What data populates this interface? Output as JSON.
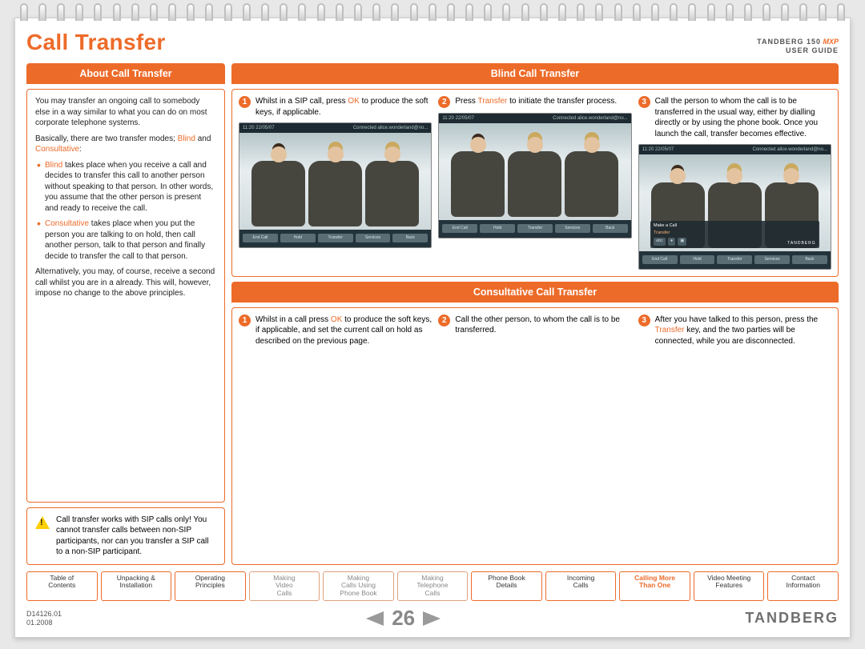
{
  "header": {
    "title": "Call Transfer",
    "brand": "TANDBERG 150",
    "model": "MXP",
    "subtitle": "USER GUIDE"
  },
  "sidebar": {
    "heading": "About Call Transfer",
    "para1": "You may transfer an ongoing call to somebody else in a way similar to what you can do on most corporate telephone systems.",
    "para2_a": "Basically, there are two transfer modes; ",
    "para2_b": "Blind",
    "para2_c": " and ",
    "para2_d": "Consultative",
    "para2_e": ":",
    "bullets": [
      {
        "lead": "Blind",
        "rest": " takes place when you receive a call and decides to transfer this call to another person without speaking to that person. In other words, you assume that the other person is present and ready to receive the call."
      },
      {
        "lead": "Consultative",
        "rest": " takes place when you put the person you are talking to on hold, then call another person, talk to that person and finally decide to transfer the call to that person."
      }
    ],
    "para3": "Alternatively, you may, of course, receive a second call whilst you are in a already. This will, however, impose no change to the above principles.",
    "warning": "Call transfer works with SIP calls only! You cannot transfer calls between non-SIP participants, nor can you transfer a SIP call to a non-SIP participant."
  },
  "blind": {
    "heading": "Blind Call Transfer",
    "steps": [
      {
        "n": "1",
        "pre": "Whilst in a SIP call, press ",
        "k": "OK",
        "post": " to produce the soft keys, if applicable."
      },
      {
        "n": "2",
        "pre": "Press ",
        "k": "Transfer",
        "post": " to initiate the transfer process."
      },
      {
        "n": "3",
        "pre": "",
        "k": "",
        "post": "Call the person to whom the call is to be transferred in the usual way, either by dialling directly or by using the phone book. Once you launch the call, transfer becomes effective."
      }
    ],
    "thumb_status_left": "11:20 22/05/07",
    "thumb_status_right": "Connected alice.wonderland@no...",
    "softkeys": [
      "End Call",
      "Hold",
      "Transfer",
      "Services",
      "Back"
    ],
    "menu_title": "Make a Call",
    "menu_item": "Transfer",
    "menu_brand": "TANDBERG"
  },
  "consult": {
    "heading": "Consultative Call Transfer",
    "steps": [
      {
        "n": "1",
        "pre": "Whilst in a call press ",
        "k": "OK",
        "post": " to produce the soft keys, if applicable, and set the current call on hold as described on the previous page."
      },
      {
        "n": "2",
        "pre": "",
        "k": "",
        "post": "Call the other person, to whom the call is to be transferred."
      },
      {
        "n": "3",
        "pre": "After you have talked to this person, press the ",
        "k": "Transfer",
        "post": " key, and the two parties will be connected, while you are disconnected."
      }
    ]
  },
  "crumbs": [
    {
      "l1": "Table of",
      "l2": "Contents",
      "state": "on"
    },
    {
      "l1": "Unpacking &",
      "l2": "Installation",
      "state": "on"
    },
    {
      "l1": "Operating",
      "l2": "Principles",
      "state": "on"
    },
    {
      "l1": "Making",
      "l2": "Video",
      "l3": "Calls",
      "state": "off"
    },
    {
      "l1": "Making",
      "l2": "Calls Using",
      "l3": "Phone Book",
      "state": "off"
    },
    {
      "l1": "Making",
      "l2": "Telephone",
      "l3": "Calls",
      "state": "off"
    },
    {
      "l1": "Phone Book",
      "l2": "Details",
      "state": "on"
    },
    {
      "l1": "Incoming",
      "l2": "Calls",
      "state": "on"
    },
    {
      "l1": "Calling More",
      "l2": "Than One",
      "state": "active"
    },
    {
      "l1": "Video Meeting",
      "l2": "Features",
      "state": "on"
    },
    {
      "l1": "Contact",
      "l2": "Information",
      "state": "on"
    }
  ],
  "footer": {
    "doc_id": "D14126.01",
    "doc_date": "01.2008",
    "page": "26",
    "brand": "TANDBERG"
  }
}
